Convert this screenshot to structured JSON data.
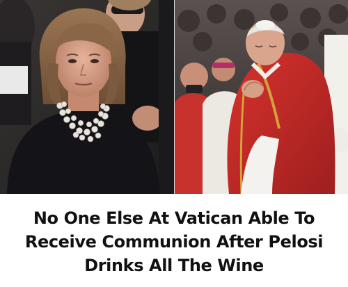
{
  "caption": {
    "lines": [
      "No One Else At Vatican Able To",
      "Receive Communion After Pelosi",
      "Drinks All The Wine"
    ]
  },
  "colors": {
    "caption_text": "#111111",
    "background": "#ffffff",
    "vestment_red": "#c0282a"
  }
}
